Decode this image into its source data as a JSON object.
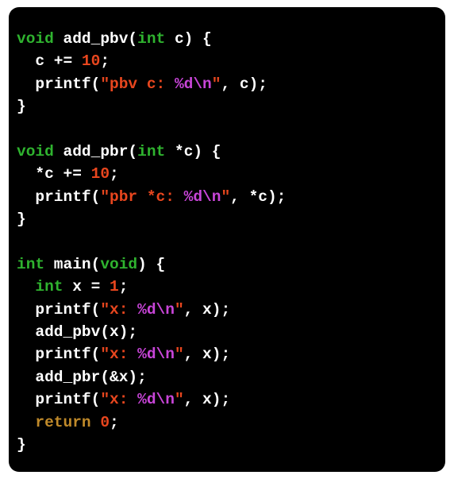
{
  "colors": {
    "background": "#000000",
    "keyword": "#2fb32f",
    "number": "#e8461e",
    "string": "#e8461e",
    "format_specifier": "#c845d8",
    "control_keyword": "#c08a2a",
    "plain": "#ffffff"
  },
  "code": {
    "lines": [
      [
        {
          "t": "keyword",
          "v": "void"
        },
        {
          "t": "plain",
          "v": " add_pbv("
        },
        {
          "t": "keyword",
          "v": "int"
        },
        {
          "t": "plain",
          "v": " c) {"
        }
      ],
      [
        {
          "t": "plain",
          "v": "  c += "
        },
        {
          "t": "number",
          "v": "10"
        },
        {
          "t": "plain",
          "v": ";"
        }
      ],
      [
        {
          "t": "plain",
          "v": "  printf("
        },
        {
          "t": "string",
          "v": "\"pbv c: "
        },
        {
          "t": "format",
          "v": "%d\\n"
        },
        {
          "t": "string",
          "v": "\""
        },
        {
          "t": "plain",
          "v": ", c);"
        }
      ],
      [
        {
          "t": "plain",
          "v": "}"
        }
      ],
      [],
      [
        {
          "t": "keyword",
          "v": "void"
        },
        {
          "t": "plain",
          "v": " add_pbr("
        },
        {
          "t": "keyword",
          "v": "int"
        },
        {
          "t": "plain",
          "v": " *c) {"
        }
      ],
      [
        {
          "t": "plain",
          "v": "  *c += "
        },
        {
          "t": "number",
          "v": "10"
        },
        {
          "t": "plain",
          "v": ";"
        }
      ],
      [
        {
          "t": "plain",
          "v": "  printf("
        },
        {
          "t": "string",
          "v": "\"pbr *c: "
        },
        {
          "t": "format",
          "v": "%d\\n"
        },
        {
          "t": "string",
          "v": "\""
        },
        {
          "t": "plain",
          "v": ", *c);"
        }
      ],
      [
        {
          "t": "plain",
          "v": "}"
        }
      ],
      [],
      [
        {
          "t": "keyword",
          "v": "int"
        },
        {
          "t": "plain",
          "v": " main("
        },
        {
          "t": "keyword",
          "v": "void"
        },
        {
          "t": "plain",
          "v": ") {"
        }
      ],
      [
        {
          "t": "plain",
          "v": "  "
        },
        {
          "t": "keyword",
          "v": "int"
        },
        {
          "t": "plain",
          "v": " x = "
        },
        {
          "t": "number",
          "v": "1"
        },
        {
          "t": "plain",
          "v": ";"
        }
      ],
      [
        {
          "t": "plain",
          "v": "  printf("
        },
        {
          "t": "string",
          "v": "\"x: "
        },
        {
          "t": "format",
          "v": "%d\\n"
        },
        {
          "t": "string",
          "v": "\""
        },
        {
          "t": "plain",
          "v": ", x);"
        }
      ],
      [
        {
          "t": "plain",
          "v": "  add_pbv(x);"
        }
      ],
      [
        {
          "t": "plain",
          "v": "  printf("
        },
        {
          "t": "string",
          "v": "\"x: "
        },
        {
          "t": "format",
          "v": "%d\\n"
        },
        {
          "t": "string",
          "v": "\""
        },
        {
          "t": "plain",
          "v": ", x);"
        }
      ],
      [
        {
          "t": "plain",
          "v": "  add_pbr(&x);"
        }
      ],
      [
        {
          "t": "plain",
          "v": "  printf("
        },
        {
          "t": "string",
          "v": "\"x: "
        },
        {
          "t": "format",
          "v": "%d\\n"
        },
        {
          "t": "string",
          "v": "\""
        },
        {
          "t": "plain",
          "v": ", x);"
        }
      ],
      [
        {
          "t": "plain",
          "v": "  "
        },
        {
          "t": "control",
          "v": "return"
        },
        {
          "t": "plain",
          "v": " "
        },
        {
          "t": "number",
          "v": "0"
        },
        {
          "t": "plain",
          "v": ";"
        }
      ],
      [
        {
          "t": "plain",
          "v": "}"
        }
      ]
    ]
  }
}
